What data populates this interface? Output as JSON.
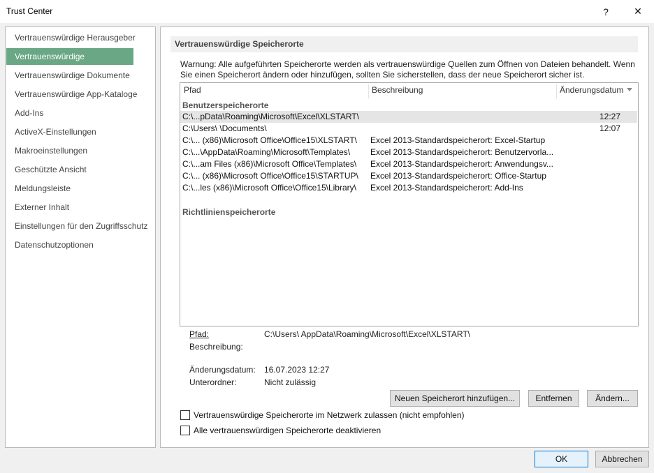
{
  "window": {
    "title": "Trust Center",
    "help_glyph": "?",
    "close_glyph": "✕"
  },
  "sidebar": {
    "items": [
      {
        "label": "Vertrauenswürdige Herausgeber"
      },
      {
        "label": "Vertrauenswürdige Speicherorte",
        "active": true
      },
      {
        "label": "Vertrauenswürdige Dokumente"
      },
      {
        "label": "Vertrauenswürdige App-Kataloge"
      },
      {
        "label": "Add-Ins"
      },
      {
        "label": "ActiveX-Einstellungen"
      },
      {
        "label": "Makroeinstellungen"
      },
      {
        "label": "Geschützte Ansicht"
      },
      {
        "label": "Meldungsleiste"
      },
      {
        "label": "Externer Inhalt"
      },
      {
        "label": "Einstellungen für den Zugriffsschutz"
      },
      {
        "label": "Datenschutzoptionen"
      }
    ]
  },
  "main": {
    "section_title": "Vertrauenswürdige Speicherorte",
    "warning": "Warnung: Alle aufgeführten Speicherorte werden als vertrauenswürdige Quellen zum Öffnen von Dateien behandelt. Wenn Sie einen Speicherort ändern oder hinzufügen, sollten Sie sicherstellen, dass der neue Speicherort sicher ist.",
    "columns": {
      "path": "Pfad",
      "description": "Beschreibung",
      "date": "Änderungsdatum"
    },
    "user_group": "Benutzerspeicherorte",
    "rows": [
      {
        "path": "C:\\...pData\\Roaming\\Microsoft\\Excel\\XLSTART\\",
        "description": "",
        "date": "12:27",
        "selected": true
      },
      {
        "path": "C:\\Users\\     \\Documents\\",
        "description": "",
        "date": "12:07"
      },
      {
        "path": "C:\\... (x86)\\Microsoft Office\\Office15\\XLSTART\\",
        "description": "Excel 2013-Standardspeicherort: Excel-Startup",
        "date": ""
      },
      {
        "path": "C:\\...\\AppData\\Roaming\\Microsoft\\Templates\\",
        "description": "Excel 2013-Standardspeicherort: Benutzervorla...",
        "date": ""
      },
      {
        "path": "C:\\...am Files (x86)\\Microsoft Office\\Templates\\",
        "description": "Excel 2013-Standardspeicherort: Anwendungsv...",
        "date": ""
      },
      {
        "path": "C:\\... (x86)\\Microsoft Office\\Office15\\STARTUP\\",
        "description": "Excel 2013-Standardspeicherort: Office-Startup",
        "date": ""
      },
      {
        "path": "C:\\...les (x86)\\Microsoft Office\\Office15\\Library\\",
        "description": "Excel 2013-Standardspeicherort: Add-Ins",
        "date": ""
      }
    ],
    "policy_group": "Richtlinienspeicherorte",
    "details": {
      "path_label": "Pfad:",
      "path_value": "C:\\Users\\      AppData\\Roaming\\Microsoft\\Excel\\XLSTART\\",
      "desc_label": "Beschreibung:",
      "date_label": "Änderungsdatum:",
      "date_value": "16.07.2023 12:27",
      "sub_label": "Unterordner:",
      "sub_value": "Nicht zulässig"
    },
    "buttons": {
      "add": "Neuen Speicherort hinzufügen...",
      "remove": "Entfernen",
      "change": "Ändern..."
    },
    "checkboxes": {
      "network": "Vertrauenswürdige Speicherorte im Netzwerk zulassen (nicht empfohlen)",
      "disable": "Alle vertrauenswürdigen Speicherorte deaktivieren"
    }
  },
  "footer": {
    "ok": "OK",
    "cancel": "Abbrechen"
  }
}
